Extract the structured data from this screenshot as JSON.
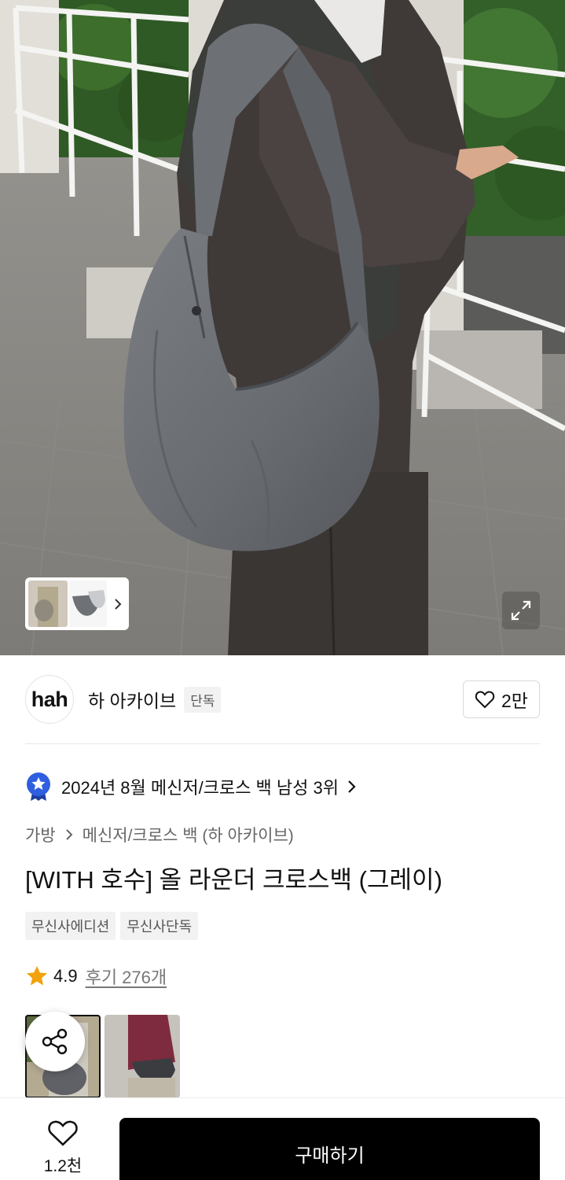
{
  "hero": {
    "image_alt": "Person wearing a gray round crossbody bag on a wet marble terrace",
    "thumbnails_chevron_icon": "chevron-right-icon",
    "expand_icon": "expand-icon"
  },
  "brand": {
    "logo_text": "hah",
    "name": "하 아카이브",
    "tag": "단독",
    "likes": "2만",
    "like_icon": "heart-outline-icon"
  },
  "ranking": {
    "icon": "award-badge-icon",
    "text": "2024년 8월 메신저/크로스 백 남성 3위",
    "badge_color": "#2f5fe0"
  },
  "breadcrumb": {
    "items": [
      "가방",
      "메신저/크로스 백 (하 아카이브)"
    ]
  },
  "product": {
    "title": "[WITH 호수] 올 라운더 크로스백 (그레이)",
    "tags": [
      "무신사에디션",
      "무신사단독"
    ]
  },
  "rating": {
    "score": "4.9",
    "reviews": "후기 276개",
    "star_color": "#f2a20c"
  },
  "share": {
    "icon": "share-icon"
  },
  "bottom_bar": {
    "wish_count": "1.2천",
    "buy_label": "구매하기"
  }
}
